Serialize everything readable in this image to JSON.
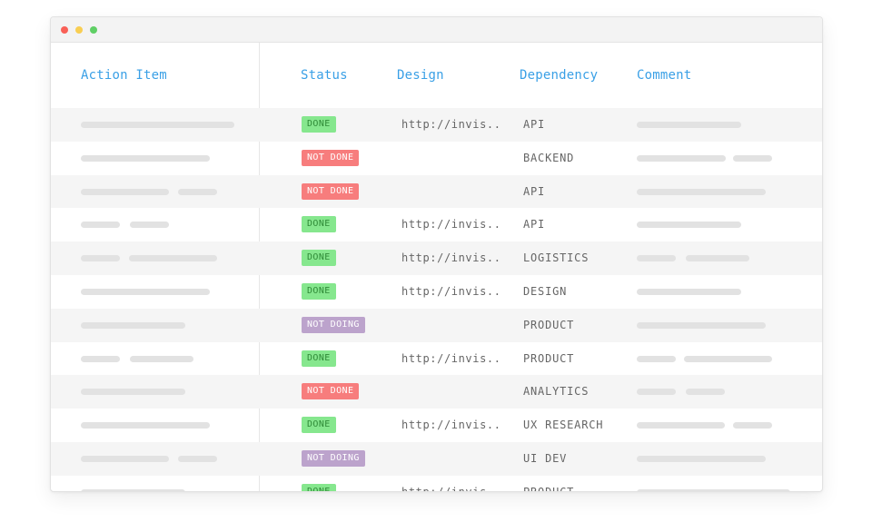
{
  "window": {
    "controls": [
      "close",
      "minimize",
      "maximize"
    ]
  },
  "table": {
    "columns": {
      "action_item": "Action Item",
      "status": "Status",
      "design": "Design",
      "dependency": "Dependency",
      "comment": "Comment"
    },
    "status_colors": {
      "done": "#86e78e",
      "not_done": "#f77d7d",
      "not_doing": "#bca3cc"
    },
    "rows": [
      {
        "status": "DONE",
        "status_kind": "done",
        "design": "http://invis..",
        "dependency": "API"
      },
      {
        "status": "NOT DONE",
        "status_kind": "notdone",
        "design": "",
        "dependency": "BACKEND"
      },
      {
        "status": "NOT DONE",
        "status_kind": "notdone",
        "design": "",
        "dependency": "API"
      },
      {
        "status": "DONE",
        "status_kind": "done",
        "design": "http://invis..",
        "dependency": "API"
      },
      {
        "status": "DONE",
        "status_kind": "done",
        "design": "http://invis..",
        "dependency": "LOGISTICS"
      },
      {
        "status": "DONE",
        "status_kind": "done",
        "design": "http://invis..",
        "dependency": "DESIGN"
      },
      {
        "status": "NOT DOING",
        "status_kind": "notdoing",
        "design": "",
        "dependency": "PRODUCT"
      },
      {
        "status": "DONE",
        "status_kind": "done",
        "design": "http://invis..",
        "dependency": "PRODUCT"
      },
      {
        "status": "NOT DONE",
        "status_kind": "notdone",
        "design": "",
        "dependency": "ANALYTICS"
      },
      {
        "status": "DONE",
        "status_kind": "done",
        "design": "http://invis..",
        "dependency": "UX RESEARCH"
      },
      {
        "status": "NOT DOING",
        "status_kind": "notdoing",
        "design": "",
        "dependency": "UI DEV"
      },
      {
        "status": "DONE",
        "status_kind": "done",
        "design": "http://invis..",
        "dependency": "PRODUCT"
      }
    ]
  }
}
